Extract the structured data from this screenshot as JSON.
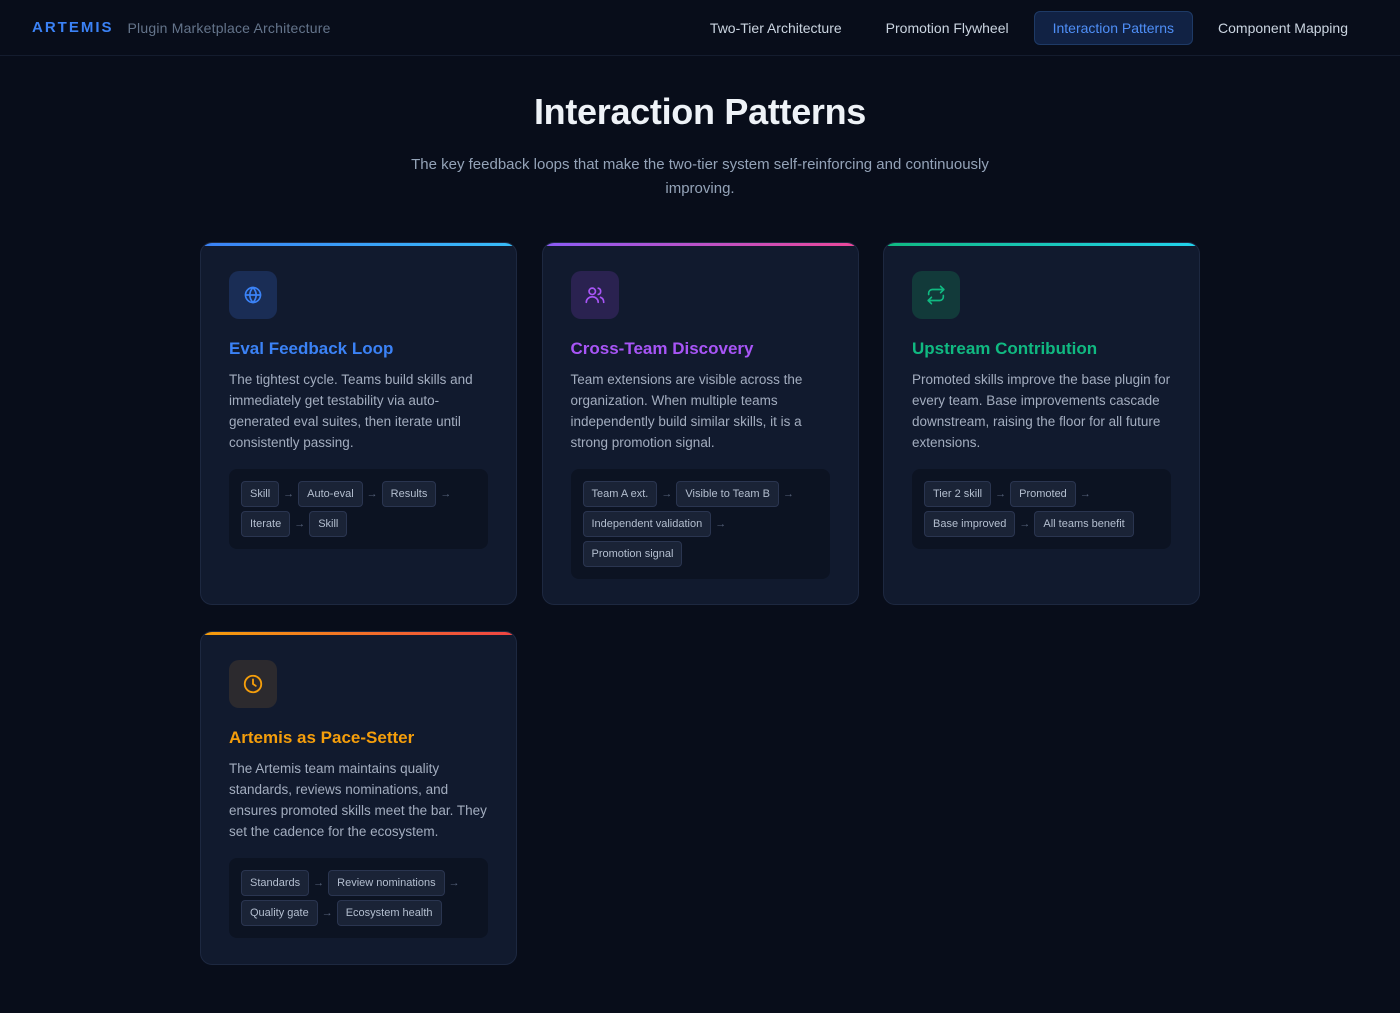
{
  "app": {
    "brand": "ARTEMIS",
    "subtitle": "Plugin Marketplace Architecture"
  },
  "nav": {
    "items": [
      {
        "label": "Two-Tier Architecture",
        "active": false
      },
      {
        "label": "Promotion Flywheel",
        "active": false
      },
      {
        "label": "Interaction Patterns",
        "active": true
      },
      {
        "label": "Component Mapping",
        "active": false
      }
    ]
  },
  "page": {
    "title": "Interaction Patterns",
    "subtitle": "The key feedback loops that make the two-tier system self-reinforcing and continuously improving."
  },
  "cards": [
    {
      "title": "Eval Feedback Loop",
      "icon": "globe-icon",
      "color": "#3b82f6",
      "bar": [
        "#3b82f6",
        "#38bdf8"
      ],
      "description": "The tightest cycle. Teams build skills and immediately get testability via auto-generated eval suites, then iterate until consistently passing.",
      "flow": [
        "Skill",
        "Auto-eval",
        "Results",
        "Iterate",
        "Skill"
      ]
    },
    {
      "title": "Cross-Team Discovery",
      "icon": "users-icon",
      "color": "#a855f7",
      "bar": [
        "#8b5cf6",
        "#ec4899"
      ],
      "description": "Team extensions are visible across the organization. When multiple teams independently build similar skills, it is a strong promotion signal.",
      "flow": [
        "Team A ext.",
        "Visible to Team B",
        "Independent validation",
        "Promotion signal"
      ]
    },
    {
      "title": "Upstream Contribution",
      "icon": "repeat-icon",
      "color": "#10b981",
      "bar": [
        "#10b981",
        "#22d3ee"
      ],
      "description": "Promoted skills improve the base plugin for every team. Base improvements cascade downstream, raising the floor for all future extensions.",
      "flow": [
        "Tier 2 skill",
        "Promoted",
        "Base improved",
        "All teams benefit"
      ]
    },
    {
      "title": "Artemis as Pace-Setter",
      "icon": "clock-icon",
      "color": "#f59e0b",
      "bar": [
        "#f59e0b",
        "#ef4444"
      ],
      "description": "The Artemis team maintains quality standards, reviews nominations, and ensures promoted skills meet the bar. They set the cadence for the ecosystem.",
      "flow": [
        "Standards",
        "Review nominations",
        "Quality gate",
        "Ecosystem health"
      ]
    }
  ],
  "flow_arrow": "→"
}
